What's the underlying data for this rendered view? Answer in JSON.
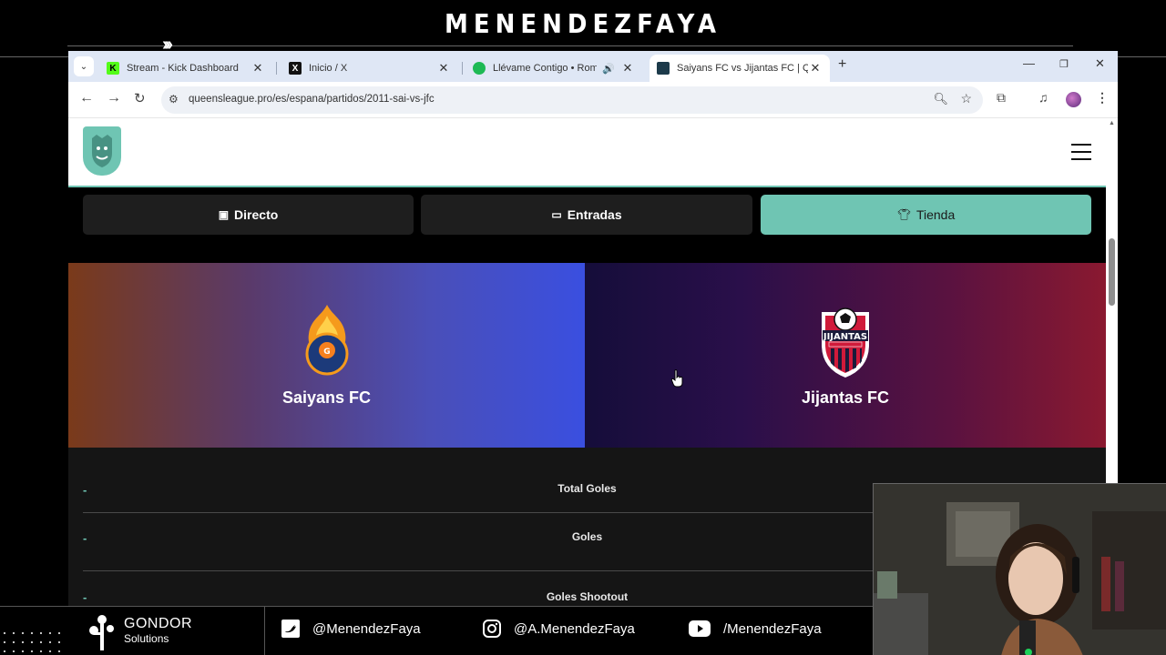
{
  "overlay": {
    "title": "MENENDEZFAYA",
    "chevrons": "›››"
  },
  "browser": {
    "tabs": [
      {
        "title": "Stream - Kick Dashboard",
        "favicon": "kick-favicon",
        "active": false
      },
      {
        "title": "Inicio / X",
        "favicon": "x-favicon",
        "active": false
      },
      {
        "title": "Llévame Contigo • Romeo S",
        "favicon": "spotify-favicon",
        "active": false,
        "audio": true
      },
      {
        "title": "Saiyans FC vs Jijantas FC | Quee",
        "favicon": "queensleague-favicon",
        "active": true
      }
    ],
    "url": "queensleague.pro/es/espana/partidos/2011-sai-vs-jfc"
  },
  "site": {
    "buttons": {
      "directo": "Directo",
      "entradas": "Entradas",
      "tienda": "Tienda"
    },
    "home_team": "Saiyans FC",
    "away_team": "Jijantas FC",
    "crest_away_text": "JIJANTAS",
    "stats": [
      {
        "label": "Total Goles",
        "home": "-"
      },
      {
        "label": "Goles",
        "home": "-"
      },
      {
        "label": "Goles Shootout",
        "home": "-"
      }
    ]
  },
  "bottombar": {
    "brand_line1": "GONDOR",
    "brand_line2": "Solutions",
    "twitter": "@MenendezFaya",
    "instagram": "@A.MenendezFaya",
    "youtube": "/MenendezFaya"
  },
  "colors": {
    "accent": "#6fc5b3",
    "home_gradient_end": "#3a4fe0",
    "away_gradient_end": "#8a1930"
  }
}
